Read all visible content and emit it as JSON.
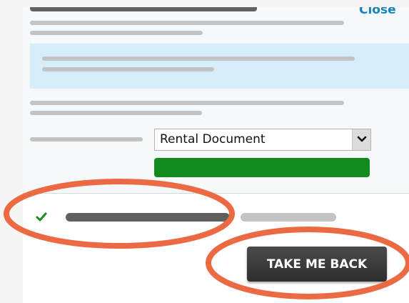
{
  "header": {
    "close_label": "Close"
  },
  "form": {
    "document_select": {
      "selected": "Rental Document"
    }
  },
  "actions": {
    "take_me_back_label": "TAKE ME BACK"
  },
  "icons": {
    "success": "checkmark-icon",
    "dropdown": "chevron-down-icon"
  },
  "colors": {
    "accent_link": "#1b82b6",
    "info_background": "#d5eef9",
    "primary_green": "#138a1c",
    "success_check": "#1a8a1a",
    "button_dark": "#3a3a3a",
    "annotation_circle": "#ec6a43"
  }
}
